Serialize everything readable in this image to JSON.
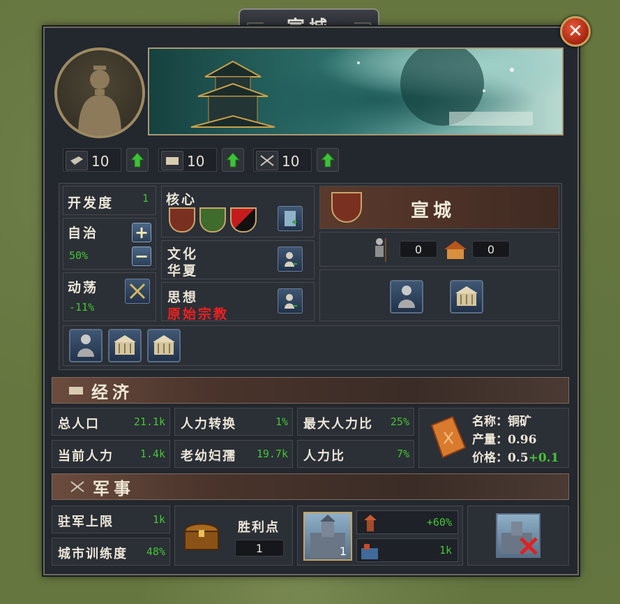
{
  "window": {
    "title": "宣城",
    "close_symbol": "✕"
  },
  "stats": [
    {
      "icon": "wrench-icon",
      "value": "10"
    },
    {
      "icon": "scroll-icon",
      "value": "10"
    },
    {
      "icon": "crossed-swords-icon",
      "value": "10"
    }
  ],
  "province": {
    "development": {
      "label": "开发度",
      "value": "1"
    },
    "autonomy": {
      "label": "自治",
      "value": "50%",
      "plus": "+",
      "minus": "−"
    },
    "unrest": {
      "label": "动荡",
      "value": "-11%"
    },
    "core": {
      "label": "核心"
    },
    "culture": {
      "label": "文化",
      "value": "华夏"
    },
    "religion": {
      "label": "思想",
      "value": "原始宗教"
    }
  },
  "owner": {
    "name": "宣城",
    "soldiers": "0",
    "buildings": "0"
  },
  "economy": {
    "title": "经济",
    "total_population": {
      "label": "总人口",
      "value": "21.1k"
    },
    "manpower_conversion": {
      "label": "人力转换",
      "value": "1%"
    },
    "max_manpower_ratio": {
      "label": "最大人力比",
      "value": "25%"
    },
    "current_manpower": {
      "label": "当前人力",
      "value": "1.4k"
    },
    "elderly_women_children": {
      "label": "老幼妇孺",
      "value": "19.7k"
    },
    "manpower_ratio": {
      "label": "人力比",
      "value": "7%"
    },
    "resource": {
      "name_label": "名称：",
      "name": "铜矿",
      "output_label": "产量：",
      "output": "0.96",
      "price_label": "价格：",
      "price": "0.5",
      "price_delta": "+0.1"
    }
  },
  "military": {
    "title": "军事",
    "garrison_cap": {
      "label": "驻军上限",
      "value": "1k"
    },
    "city_training": {
      "label": "城市训练度",
      "value": "48%"
    },
    "victory_points": {
      "label": "胜利点",
      "value": "1"
    },
    "fort_level": "1",
    "fort_bonus": "+60%",
    "fort_garrison": "1k"
  },
  "colors": {
    "accent_green": "#44c534",
    "religion_red": "#ee2020",
    "panel": "#23272e",
    "section_bar": "#5a3f34"
  }
}
